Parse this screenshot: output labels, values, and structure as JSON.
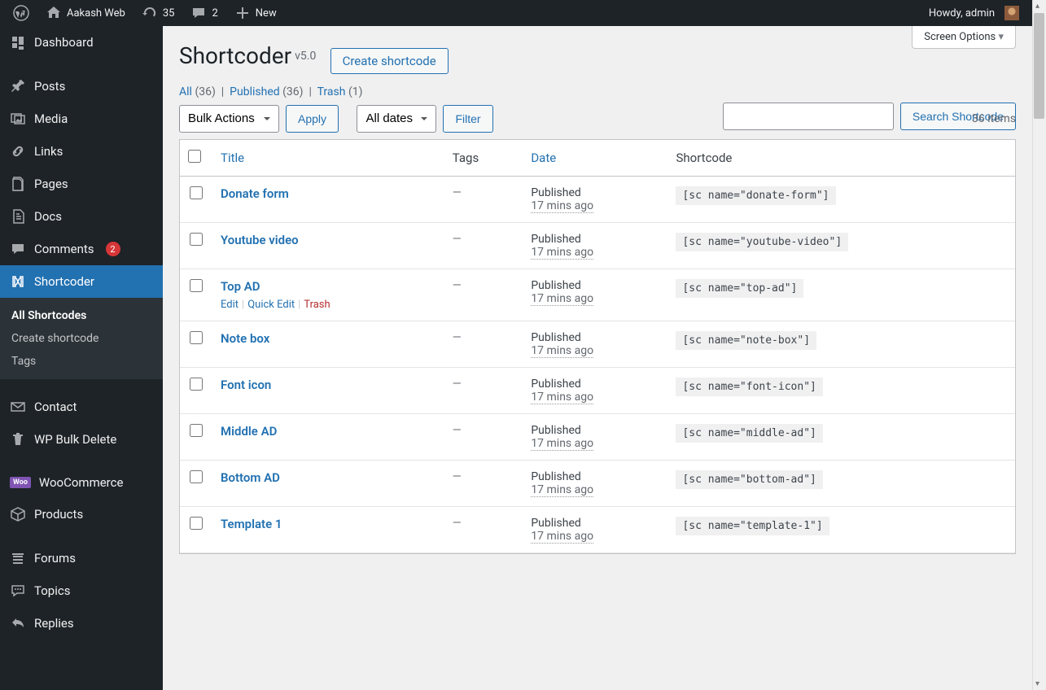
{
  "topbar": {
    "site_name": "Aakash Web",
    "updates": "35",
    "comments": "2",
    "new_label": "New",
    "howdy": "Howdy, admin"
  },
  "sidebar": {
    "items": [
      {
        "label": "Dashboard",
        "icon": "dashboard"
      },
      {
        "label": "Posts",
        "icon": "pin"
      },
      {
        "label": "Media",
        "icon": "media"
      },
      {
        "label": "Links",
        "icon": "links"
      },
      {
        "label": "Pages",
        "icon": "pages"
      },
      {
        "label": "Docs",
        "icon": "docs"
      },
      {
        "label": "Comments",
        "icon": "comments",
        "badge": "2"
      },
      {
        "label": "Shortcoder",
        "icon": "shortcoder",
        "active": true
      },
      {
        "label": "Contact",
        "icon": "contact"
      },
      {
        "label": "WP Bulk Delete",
        "icon": "trash"
      },
      {
        "label": "WooCommerce",
        "icon": "woo"
      },
      {
        "label": "Products",
        "icon": "products"
      },
      {
        "label": "Forums",
        "icon": "forums"
      },
      {
        "label": "Topics",
        "icon": "topics"
      },
      {
        "label": "Replies",
        "icon": "replies"
      }
    ],
    "submenu": {
      "items": [
        {
          "label": "All Shortcodes",
          "current": true
        },
        {
          "label": "Create shortcode"
        },
        {
          "label": "Tags"
        }
      ]
    }
  },
  "header": {
    "title": "Shortcoder",
    "version": "v5.0",
    "create_btn": "Create shortcode",
    "screen_options": "Screen Options"
  },
  "search": {
    "placeholder": "",
    "button": "Search Shortcode"
  },
  "filters": {
    "all": "All",
    "all_count": "(36)",
    "published": "Published",
    "published_count": "(36)",
    "trash": "Trash",
    "trash_count": "(1)"
  },
  "tablenav": {
    "bulk_label": "Bulk Actions",
    "apply": "Apply",
    "dates_label": "All dates",
    "filter": "Filter",
    "items_count": "36 items"
  },
  "table": {
    "columns": {
      "title": "Title",
      "tags": "Tags",
      "date": "Date",
      "shortcode": "Shortcode"
    },
    "row_actions": {
      "edit": "Edit",
      "quick_edit": "Quick Edit",
      "trash": "Trash"
    },
    "rows": [
      {
        "title": "Donate form",
        "tags": "—",
        "status": "Published",
        "time": "17 mins ago",
        "sc": "[sc name=\"donate-form\"]"
      },
      {
        "title": "Youtube video",
        "tags": "—",
        "status": "Published",
        "time": "17 mins ago",
        "sc": "[sc name=\"youtube-video\"]"
      },
      {
        "title": "Top AD",
        "tags": "—",
        "status": "Published",
        "time": "17 mins ago",
        "sc": "[sc name=\"top-ad\"]",
        "hover": true
      },
      {
        "title": "Note box",
        "tags": "—",
        "status": "Published",
        "time": "17 mins ago",
        "sc": "[sc name=\"note-box\"]"
      },
      {
        "title": "Font icon",
        "tags": "—",
        "status": "Published",
        "time": "17 mins ago",
        "sc": "[sc name=\"font-icon\"]"
      },
      {
        "title": "Middle AD",
        "tags": "—",
        "status": "Published",
        "time": "17 mins ago",
        "sc": "[sc name=\"middle-ad\"]"
      },
      {
        "title": "Bottom AD",
        "tags": "—",
        "status": "Published",
        "time": "17 mins ago",
        "sc": "[sc name=\"bottom-ad\"]"
      },
      {
        "title": "Template 1",
        "tags": "—",
        "status": "Published",
        "time": "17 mins ago",
        "sc": "[sc name=\"template-1\"]"
      }
    ]
  }
}
